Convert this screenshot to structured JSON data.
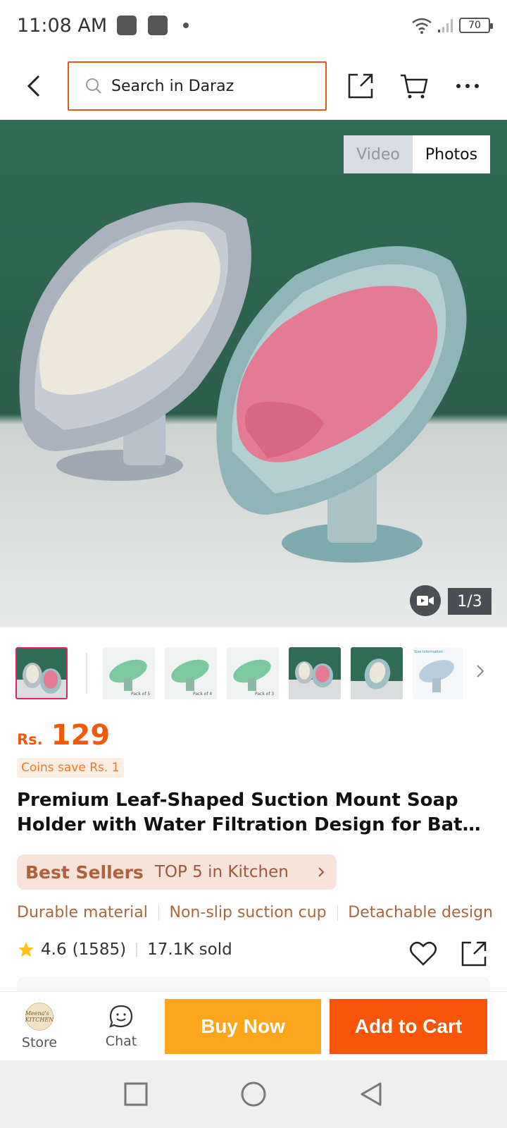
{
  "status_bar": {
    "time": "11:08 AM",
    "battery": "70"
  },
  "header": {
    "search_placeholder": "Search in Daraz"
  },
  "gallery": {
    "tabs": {
      "video": "Video",
      "photos": "Photos"
    },
    "counter": "1/3",
    "thumb_captions": [
      "Pack of 5",
      "Pack of 4",
      "Pack of 3",
      "Size Information"
    ]
  },
  "product": {
    "currency": "Rs.",
    "price": "129",
    "coins_save": "Coins save Rs. 1",
    "title_line1": "Premium Leaf-Shaped Suction Mount Soap",
    "title_line2": "Holder with Water Filtration Design for Bathroom",
    "best_sellers": {
      "badge": "Best Sellers",
      "text": "TOP 5 in Kitchen"
    },
    "features": [
      "Durable material",
      "Non-slip suction cup",
      "Detachable design"
    ],
    "rating": "4.6",
    "reviews": "(1585)",
    "sold": "17.1K sold"
  },
  "store": {
    "logo_text": "Meena's KITCHEN"
  },
  "bottom_bar": {
    "store_label": "Store",
    "chat_label": "Chat",
    "buy_now": "Buy Now",
    "add_to_cart": "Add to Cart"
  },
  "colors": {
    "accent": "#f7560a",
    "buy_now": "#fca61d",
    "search_border": "#e05a1a"
  }
}
